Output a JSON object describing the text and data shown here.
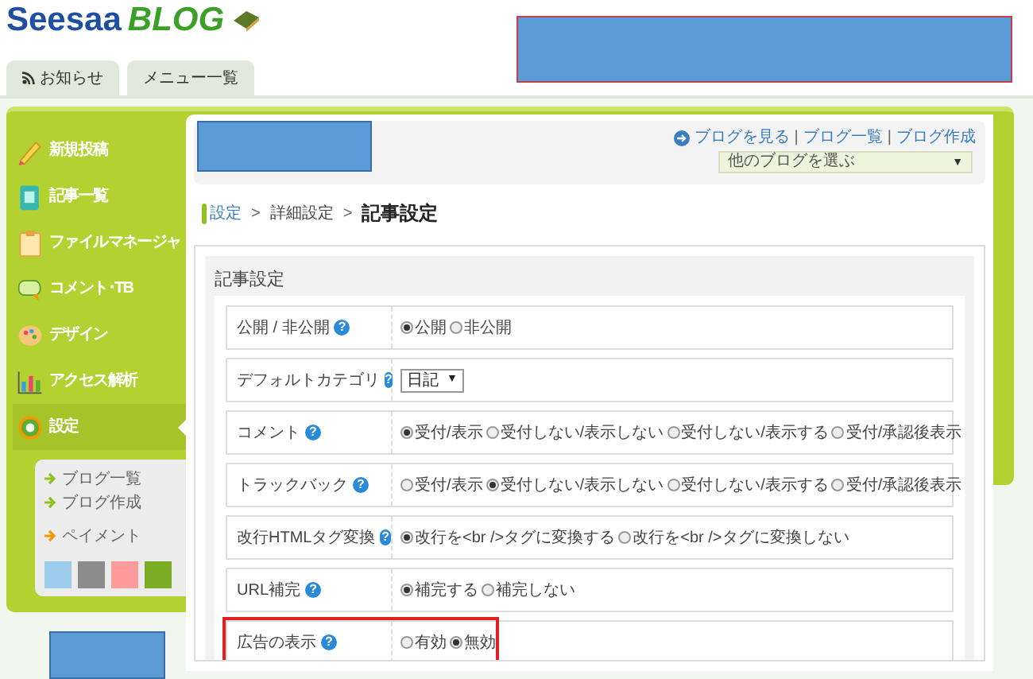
{
  "header": {
    "logo_main": "Seesaa",
    "logo_blog": "BLOG"
  },
  "tabs": [
    {
      "label": "お知らせ",
      "kind": "feed"
    },
    {
      "label": "メニュー一覧",
      "kind": "plain"
    }
  ],
  "sidebar": {
    "items": [
      {
        "label": "新規投稿",
        "selected": false
      },
      {
        "label": "記事一覧",
        "selected": false
      },
      {
        "label": "ファイルマネージャ",
        "selected": false
      },
      {
        "label": "コメント･TB",
        "selected": false
      },
      {
        "label": "デザイン",
        "selected": false
      },
      {
        "label": "アクセス解析",
        "selected": false
      },
      {
        "label": "設定",
        "selected": true
      }
    ],
    "submenu": [
      {
        "label": "ブログ一覧",
        "color": "#8dc21f"
      },
      {
        "label": "ブログ作成",
        "color": "#8dc21f"
      },
      {
        "label": "ペイメント",
        "color": "#f39800"
      }
    ],
    "swatches": [
      {
        "color": "#9ccbec"
      },
      {
        "color": "#8c8c8c"
      },
      {
        "color": "#ff9b9b"
      },
      {
        "color": "#7aab22"
      }
    ]
  },
  "main": {
    "blog_links": [
      "ブログを見る",
      "|",
      "ブログ一覧",
      "|",
      "ブログ作成"
    ],
    "blog_select": {
      "value": "他のブログを選ぶ",
      "caret": "▼"
    },
    "breadcrumb": [
      "設定",
      ">",
      "詳細設定",
      ">"
    ],
    "title": "記事設定",
    "section_title": "記事設定",
    "rows": [
      {
        "label": "公開 / 非公開",
        "help": "?",
        "kind": "radio",
        "highlighted": false,
        "options": [
          {
            "label": "公開",
            "selected": true
          },
          {
            "label": "非公開",
            "selected": false
          }
        ]
      },
      {
        "label": "デフォルトカテゴリ",
        "help": "?",
        "kind": "select",
        "highlighted": false,
        "value": "日記",
        "caret": "▼"
      },
      {
        "label": "コメント",
        "help": "?",
        "kind": "radio",
        "highlighted": false,
        "options": [
          {
            "label": "受付/表示",
            "selected": true
          },
          {
            "label": "受付しない/表示しない",
            "selected": false
          },
          {
            "label": "受付しない/表示する",
            "selected": false
          },
          {
            "label": "受付/承認後表示",
            "selected": false
          }
        ]
      },
      {
        "label": "トラックバック",
        "help": "?",
        "kind": "radio",
        "highlighted": false,
        "options": [
          {
            "label": "受付/表示",
            "selected": false
          },
          {
            "label": "受付しない/表示しない",
            "selected": true
          },
          {
            "label": "受付しない/表示する",
            "selected": false
          },
          {
            "label": "受付/承認後表示",
            "selected": false
          }
        ]
      },
      {
        "label": "改行HTMLタグ変換",
        "help": "?",
        "kind": "radio",
        "highlighted": false,
        "options": [
          {
            "label": "改行を<br />タグに変換する",
            "selected": true
          },
          {
            "label": "改行を<br />タグに変換しない",
            "selected": false
          }
        ]
      },
      {
        "label": "URL補完",
        "help": "?",
        "kind": "radio",
        "highlighted": false,
        "options": [
          {
            "label": "補完する",
            "selected": true
          },
          {
            "label": "補完しない",
            "selected": false
          }
        ]
      },
      {
        "label": "広告の表示",
        "help": "?",
        "kind": "radio",
        "highlighted": true,
        "options": [
          {
            "label": "有効",
            "selected": false
          },
          {
            "label": "無効",
            "selected": true
          }
        ]
      }
    ]
  }
}
